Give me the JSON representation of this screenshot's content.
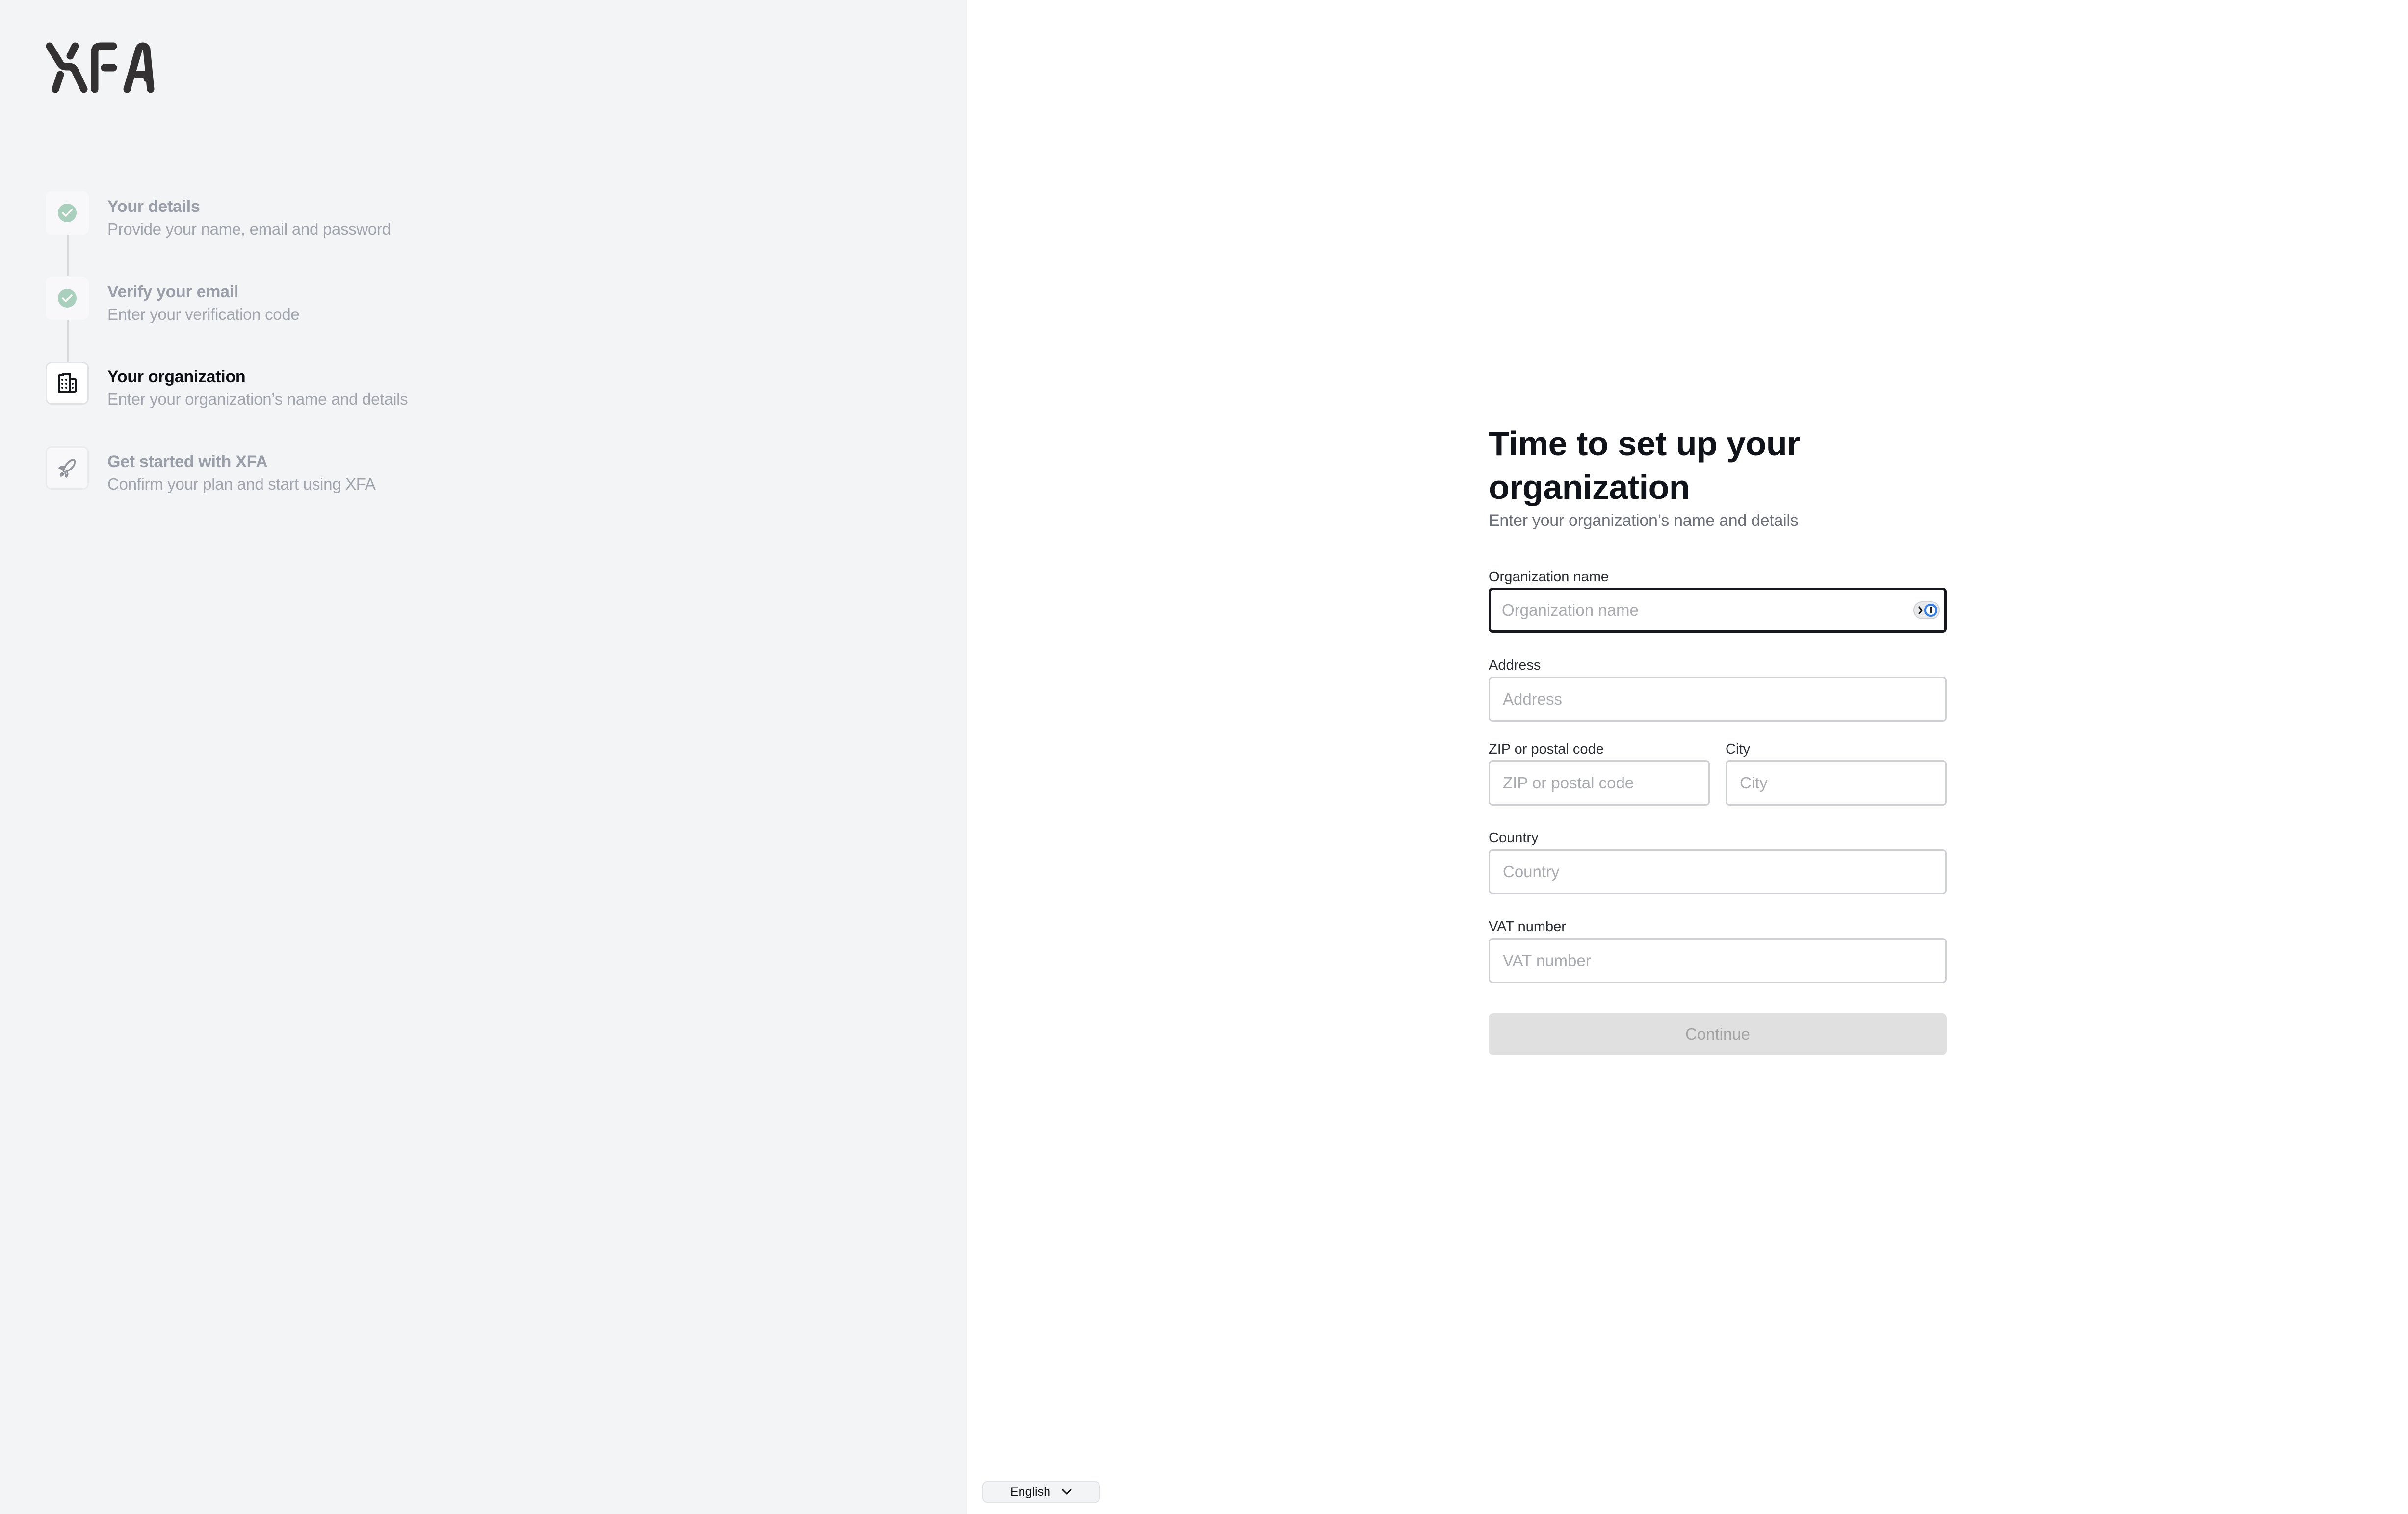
{
  "brand": {
    "logo_text": "XFA",
    "logo_color": "#333132"
  },
  "steps": [
    {
      "title": "Your details",
      "description": "Provide your name, email and password",
      "status": "completed",
      "icon": "check-circle-icon"
    },
    {
      "title": "Verify your email",
      "description": "Enter your verification code",
      "status": "completed",
      "icon": "check-circle-icon"
    },
    {
      "title": "Your organization",
      "description": "Enter your organization’s name and details",
      "status": "active",
      "icon": "building-icon"
    },
    {
      "title": "Get started with XFA",
      "description": "Confirm your plan and start using XFA",
      "status": "pending",
      "icon": "rocket-icon"
    }
  ],
  "form": {
    "title": "Time to set up your organization",
    "subtitle": "Enter your organization’s name and details",
    "fields": {
      "organization_name": {
        "label": "Organization name",
        "placeholder": "Organization name",
        "value": ""
      },
      "address": {
        "label": "Address",
        "placeholder": "Address",
        "value": ""
      },
      "zip": {
        "label": "ZIP or postal code",
        "placeholder": "ZIP or postal code",
        "value": ""
      },
      "city": {
        "label": "City",
        "placeholder": "City",
        "value": ""
      },
      "country": {
        "label": "Country",
        "placeholder": "Country",
        "value": ""
      },
      "vat": {
        "label": "VAT number",
        "placeholder": "VAT number",
        "value": ""
      }
    },
    "continue_label": "Continue",
    "continue_enabled": false
  },
  "language": {
    "selected": "English"
  },
  "colors": {
    "completed_check": "#a8d0bd",
    "password_manager_accent": "#2f7ff2",
    "left_panel_bg": "#f3f4f6"
  }
}
